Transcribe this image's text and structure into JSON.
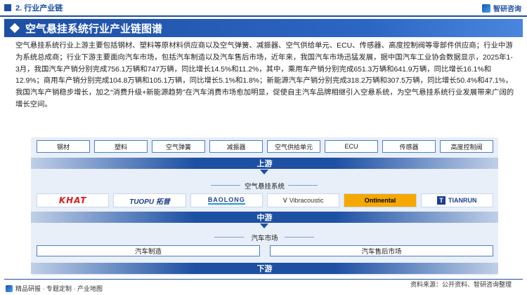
{
  "header": {
    "section": "2. 行业产业链",
    "logo_name": "智研咨询"
  },
  "title": "空气悬挂系统行业产业链图谱",
  "paragraph": "空气悬挂系统行业上游主要包括钢材、塑料等原材料供应商以及空气弹簧、减振器、空气供给单元、ECU、传感器、高度控制阀等零部件供应商；行业中游为系统总成商；行业下游主要面向汽车市场，包括汽车制造以及汽车售后市场，近年来，我国汽车市场迅猛发展，据中国汽车工业协会数据显示，2025年1-3月，我国汽车产销分别完成756.1万辆和747万辆，同比增长14.5%和11.2%，其中，乘用车产销分别完成651.3万辆和641.9万辆，同比增长16.1%和12.9%；商用车产销分别完成104.8万辆和105.1万辆，同比增长5.1%和1.8%；新能源汽车产销分别完成318.2万辆和307.5万辆，同比增长50.4%和47.1%，我国汽车产销稳步增长，加之“消费升级+新能源趋势”在汽车消费市场愈加明显，促使自主汽车品牌相继引入空悬系统，为空气悬挂系统行业发展带来广阔的增长空间。",
  "diagram": {
    "upstream_items": [
      "钢材",
      "塑料",
      "空气弹簧",
      "减振器",
      "空气供给单元",
      "ECU",
      "传感器",
      "高度控制阀"
    ],
    "upstream_label": "上游",
    "midstream_title": "空气悬挂系统",
    "midstream_brands": [
      "KHAT",
      "TUOPU 拓普",
      "BAOLONG",
      "Vibracoustic",
      "Ontinental",
      "TIANRUN"
    ],
    "midstream_label": "中游",
    "downstream_title": "汽车市场",
    "downstream_items": [
      "汽车制造",
      "汽车售后市场"
    ],
    "downstream_label": "下游"
  },
  "footer": {
    "left": "精品研报 · 专题定制 · 产业地图",
    "source": "资料来源：公开资料、智研咨询整理"
  },
  "colors": {
    "primary": "#1d4fa3",
    "panel_bg": "#e8eff8",
    "continental_yellow": "#f5a800",
    "khat_red": "#d81e1e"
  }
}
